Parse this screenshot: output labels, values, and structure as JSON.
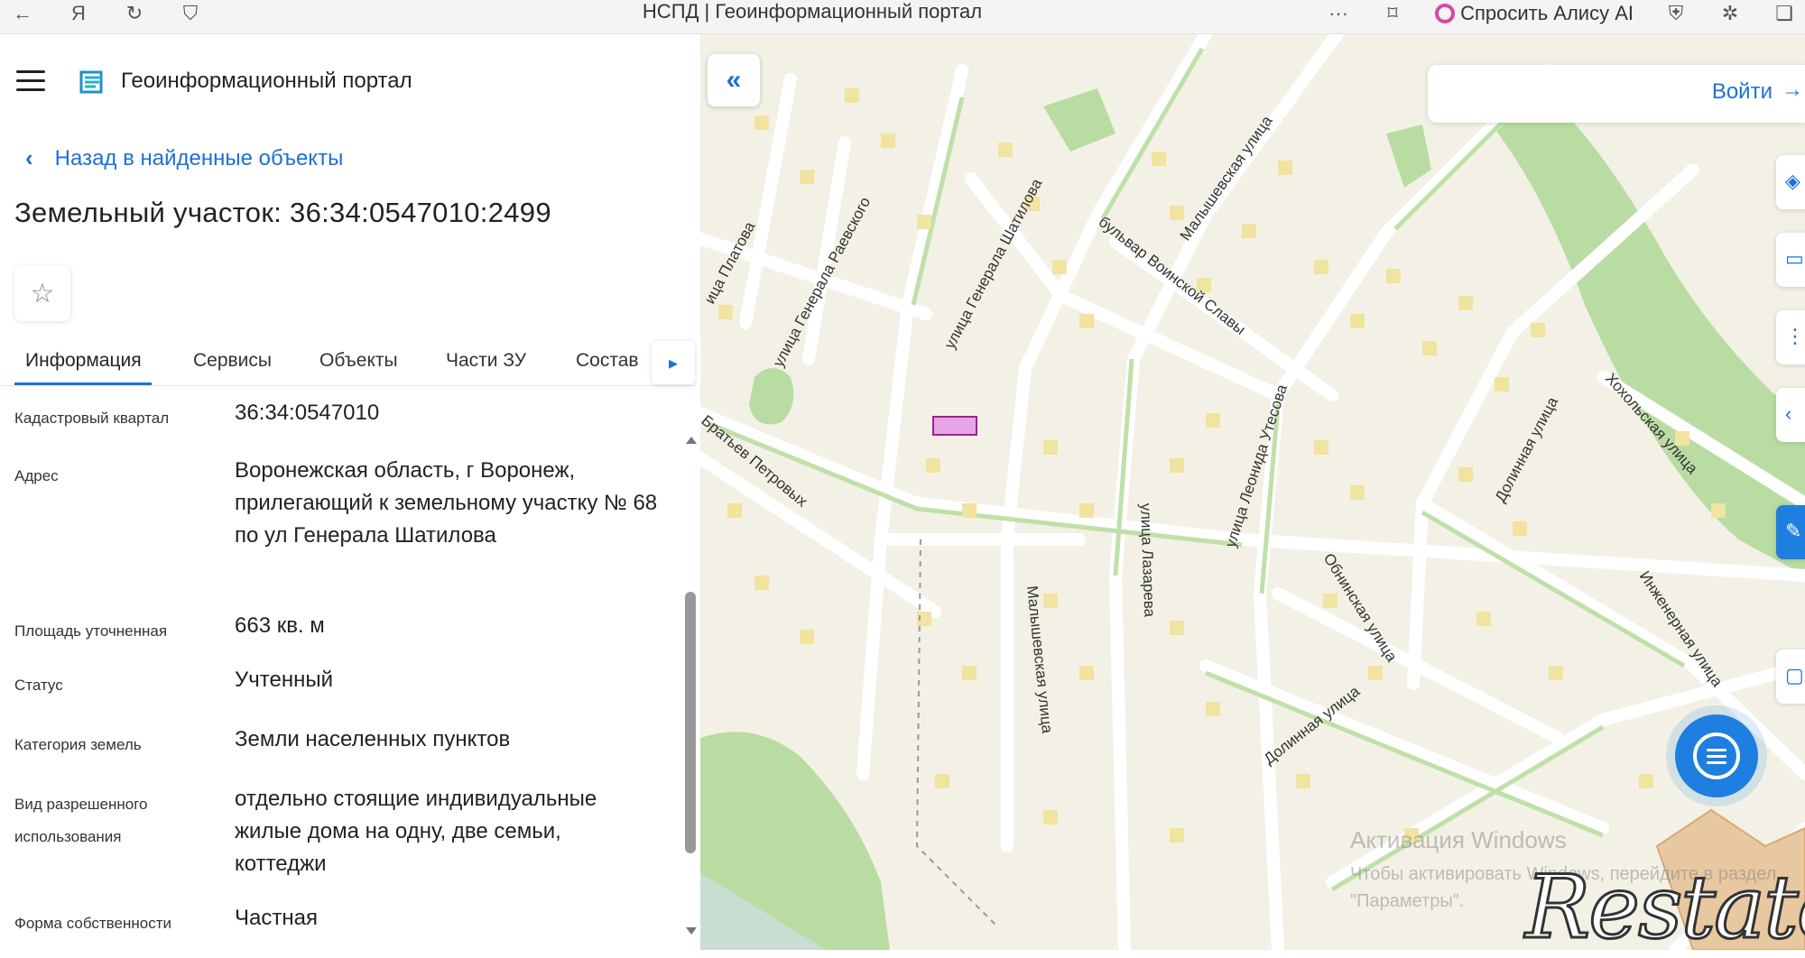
{
  "browser": {
    "title": "НСПД | Геоинформационный портал",
    "assistant_label": "Спросить Алису AI",
    "more_label": "···"
  },
  "header": {
    "portal_title": "Геоинформационный портал"
  },
  "navigation": {
    "back_label": "Назад в найденные объекты"
  },
  "object": {
    "title": "Земельный участок: 36:34:0547010:2499"
  },
  "tabs": [
    {
      "label": "Информация",
      "active": true
    },
    {
      "label": "Сервисы",
      "active": false
    },
    {
      "label": "Объекты",
      "active": false
    },
    {
      "label": "Части ЗУ",
      "active": false
    },
    {
      "label": "Состав",
      "active": false
    }
  ],
  "info_rows": [
    {
      "label": "Кадастровый квартал",
      "value": "36:34:0547010"
    },
    {
      "label": "Адрес",
      "value": "Воронежская область, г Воронеж, прилегающий к земельному участку № 68 по ул Генерала Шатилова"
    },
    {
      "label": "Площадь уточненная",
      "value": "663 кв. м"
    },
    {
      "label": "Статус",
      "value": "Учтенный"
    },
    {
      "label": "Категория земель",
      "value": "Земли населенных пунктов"
    },
    {
      "label": "Вид разрешенного использования",
      "value": "отдельно стоящие индивидуальные жилые дома на одну, две семьи, коттеджи"
    },
    {
      "label": "Форма собственности",
      "value": "Частная"
    }
  ],
  "map": {
    "login_label": "Войти",
    "streets": [
      "улица Генерала Раевского",
      "улица Генерала Шатилова",
      "бульвар Воинской Славы",
      "Малышевская улица",
      "улица Лазарева",
      "улица Леонида Утесова",
      "Обнинская улица",
      "Долинная улица",
      "Хохольская улица",
      "Инженерная улица",
      "Братьев Петровых",
      "ица Платова"
    ],
    "activation_title": "Активация Windows",
    "activation_sub": "Чтобы активировать Windows, перейдите в раздел \"Параметры\".",
    "watermark": "Restate"
  },
  "colors": {
    "accent": "#1e6fd9",
    "map_background": "#f3f1e6",
    "park": "#b9dca3",
    "house": "#f1e3a0",
    "parcel_highlight": "#e6a6e6"
  }
}
